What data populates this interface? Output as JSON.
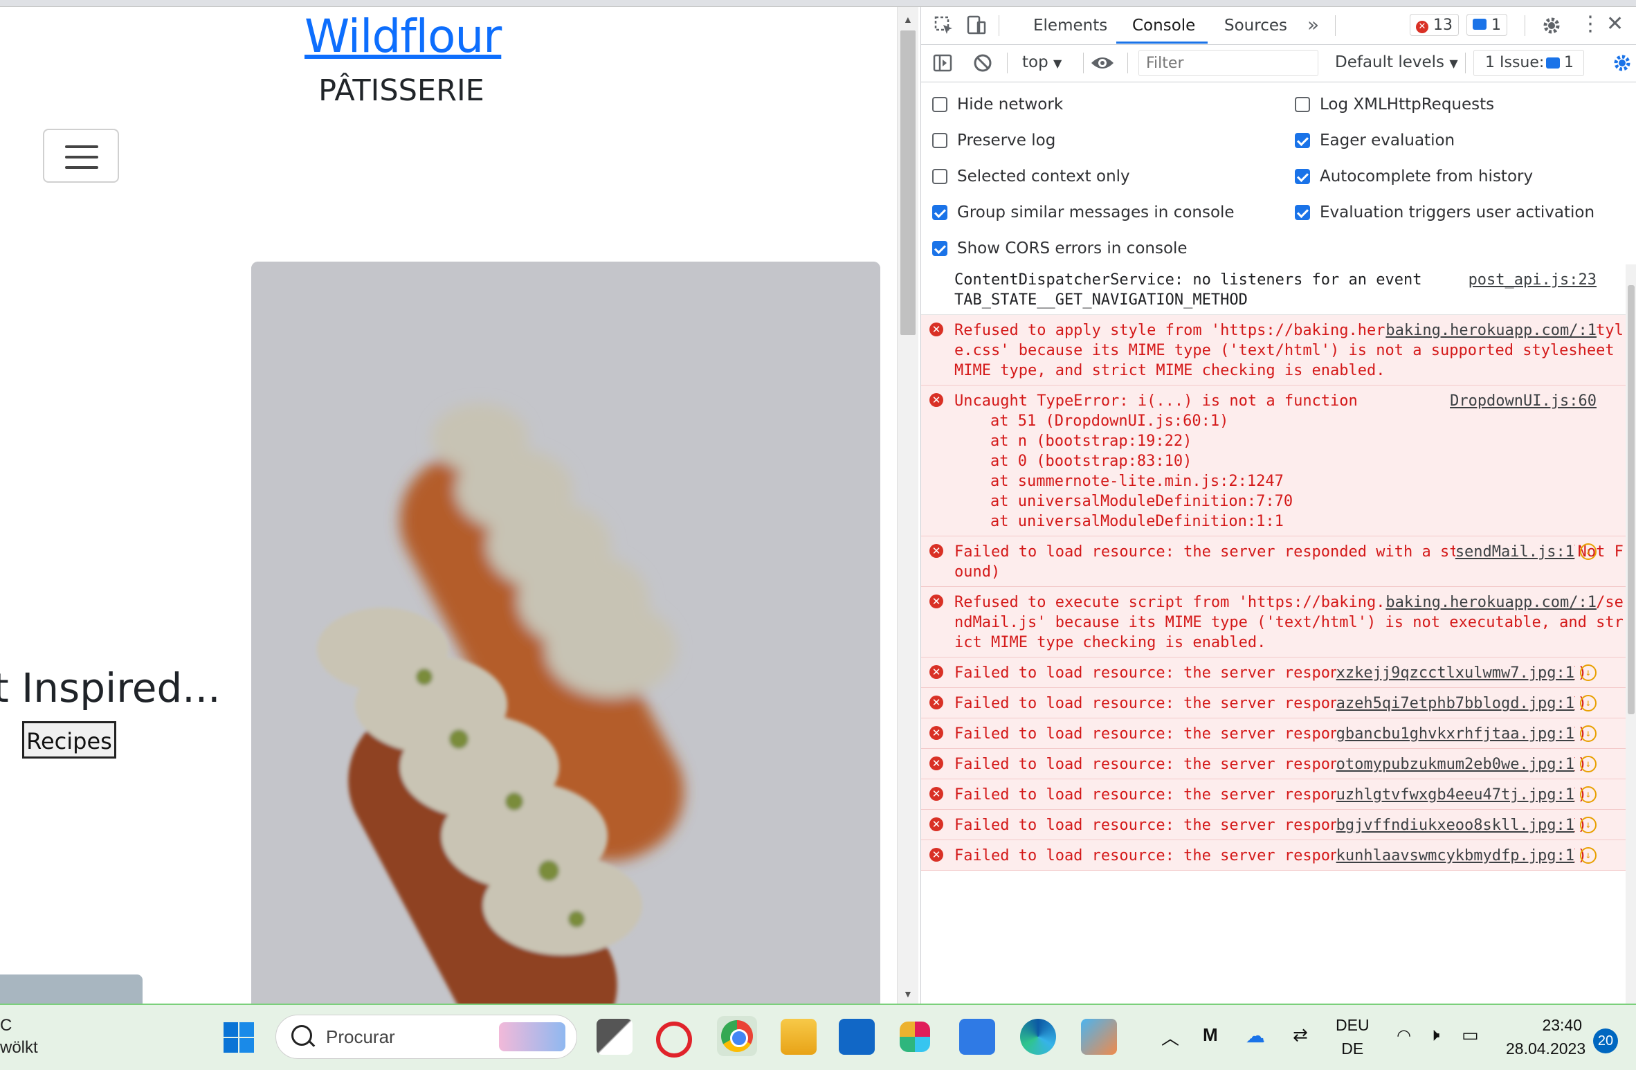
{
  "page": {
    "brand": "Wildflour",
    "subbrand": "PÂTISSERIE",
    "hero_heading": "t Inspired...",
    "recipes_button": "Recipes"
  },
  "devtools": {
    "tabs": [
      {
        "label": "Elements"
      },
      {
        "label": "Console",
        "active": true
      },
      {
        "label": "Sources"
      }
    ],
    "error_count": "13",
    "message_count": "1",
    "context": "top",
    "filter_placeholder": "Filter",
    "levels": "Default levels",
    "issues_label": "1 Issue:",
    "issues_count": "1",
    "settings_left": [
      {
        "label": "Hide network",
        "checked": false
      },
      {
        "label": "Preserve log",
        "checked": false
      },
      {
        "label": "Selected context only",
        "checked": false
      },
      {
        "label": "Group similar messages in console",
        "checked": true
      },
      {
        "label": "Show CORS errors in console",
        "checked": true
      }
    ],
    "settings_right": [
      {
        "label": "Log XMLHttpRequests",
        "checked": false
      },
      {
        "label": "Eager evaluation",
        "checked": true
      },
      {
        "label": "Autocomplete from history",
        "checked": true
      },
      {
        "label": "Evaluation triggers user activation",
        "checked": true
      }
    ],
    "messages": [
      {
        "type": "info",
        "text": "ContentDispatcherService: no listeners for an event\nTAB_STATE__GET_NAVIGATION_METHOD",
        "source": "post_api.js:23"
      },
      {
        "type": "err",
        "text": "Refused to apply style from 'https://baking.herokuapp.com/static/css/style.css' because its MIME type ('text/html') is not a supported stylesheet MIME type, and strict MIME checking is enabled.",
        "source": "baking.herokuapp.com/:1"
      },
      {
        "type": "err",
        "text": "Uncaught TypeError: i(...) is not a function",
        "source": "DropdownUI.js:60",
        "stack": [
          "at 51 (DropdownUI.js:60:1)",
          "at n (bootstrap:19:22)",
          "at 0 (bootstrap:83:10)",
          "at summernote-lite.min.js:2:1247",
          "at universalModuleDefinition:7:70",
          "at universalModuleDefinition:1:1"
        ]
      },
      {
        "type": "err",
        "text": "Failed to load resource: the server responded with a status of 404 (Not Found)",
        "source": "sendMail.js:1",
        "net": true
      },
      {
        "type": "err",
        "text": "Refused to execute script from 'https://baking.herokuapp.com/static/js/sendMail.js' because its MIME type ('text/html') is not executable, and strict MIME type checking is enabled.",
        "source": "baking.herokuapp.com/:1"
      },
      {
        "type": "err",
        "text": "Failed to load resource: the server responded with a status of 404 ()",
        "source": "xzkejj9qzcctlxulwmw7.jpg:1",
        "net": true
      },
      {
        "type": "err",
        "text": "Failed to load resource: the server responded with a status of 404 ()",
        "source": "azeh5qi7etphb7bblogd.jpg:1",
        "net": true
      },
      {
        "type": "err",
        "text": "Failed to load resource: the server responded with a status of 404 ()",
        "source": "gbancbu1ghvkxrhfjtaa.jpg:1",
        "net": true
      },
      {
        "type": "err",
        "text": "Failed to load resource: the server responded with a status of 404 ()",
        "source": "otomypubzukmum2eb0we.jpg:1",
        "net": true
      },
      {
        "type": "err",
        "text": "Failed to load resource: the server responded with a status of 404 ()",
        "source": "uzhlgtvfwxgb4eeu47tj.jpg:1",
        "net": true
      },
      {
        "type": "err",
        "text": "Failed to load resource: the server responded with a status of 404 ()",
        "source": "bgjvffndiukxeoo8skll.jpg:1",
        "net": true
      },
      {
        "type": "err",
        "text": "Failed to load resource: the server responded with a status of 404 ()",
        "source": "kunhlaavswmcykbmydfp.jpg:1",
        "net": true
      }
    ]
  },
  "taskbar": {
    "weather_line1": "C",
    "weather_line2": "wölkt",
    "search_placeholder": "Procurar",
    "lang_top": "DEU",
    "lang_bottom": "DE",
    "time": "23:40",
    "date": "28.04.2023",
    "notifications": "20",
    "colors": {
      "accent": "#0067c0",
      "taskbar_bg": "#e6f2e6"
    }
  }
}
